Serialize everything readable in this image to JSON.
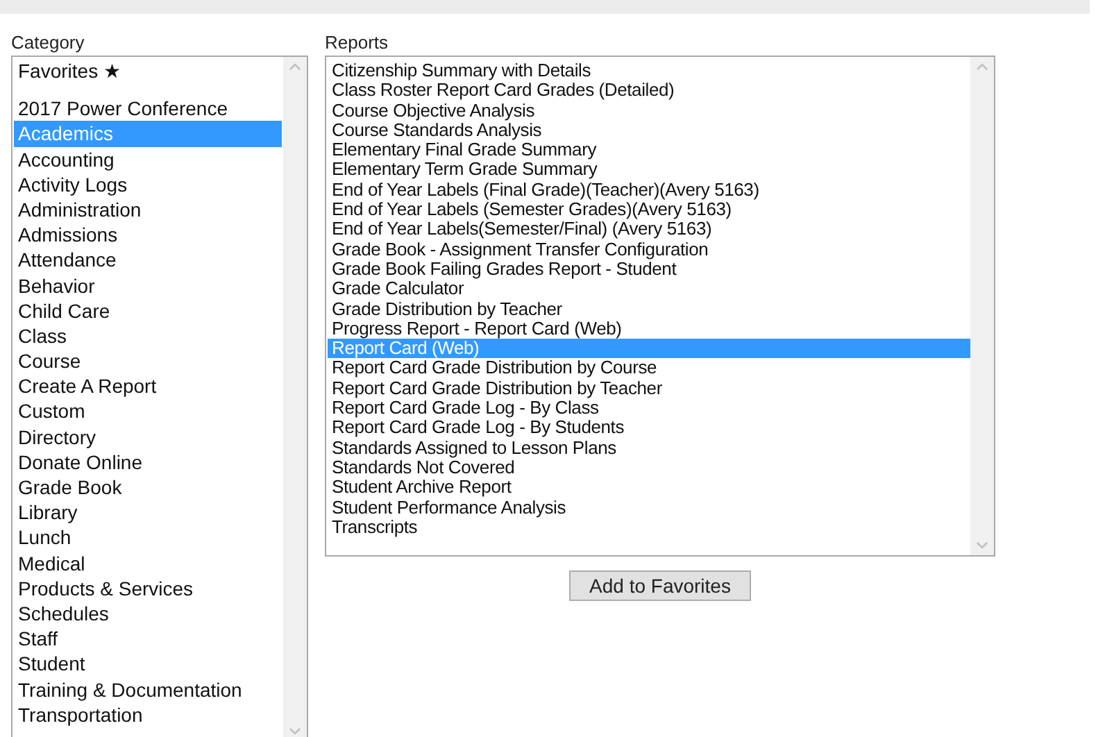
{
  "category": {
    "label": "Category",
    "items": [
      {
        "kind": "favorites",
        "label": "Favorites ★",
        "selected": false
      },
      {
        "kind": "item",
        "label": "2017 Power Conference",
        "selected": false
      },
      {
        "kind": "item",
        "label": "Academics",
        "selected": true
      },
      {
        "kind": "item",
        "label": "Accounting",
        "selected": false
      },
      {
        "kind": "item",
        "label": "Activity Logs",
        "selected": false
      },
      {
        "kind": "item",
        "label": "Administration",
        "selected": false
      },
      {
        "kind": "item",
        "label": "Admissions",
        "selected": false
      },
      {
        "kind": "item",
        "label": "Attendance",
        "selected": false
      },
      {
        "kind": "item",
        "label": "Behavior",
        "selected": false
      },
      {
        "kind": "item",
        "label": "Child Care",
        "selected": false
      },
      {
        "kind": "item",
        "label": "Class",
        "selected": false
      },
      {
        "kind": "item",
        "label": "Course",
        "selected": false
      },
      {
        "kind": "item",
        "label": "Create A Report",
        "selected": false
      },
      {
        "kind": "item",
        "label": "Custom",
        "selected": false
      },
      {
        "kind": "item",
        "label": "Directory",
        "selected": false
      },
      {
        "kind": "item",
        "label": "Donate Online",
        "selected": false
      },
      {
        "kind": "item",
        "label": "Grade Book",
        "selected": false
      },
      {
        "kind": "item",
        "label": "Library",
        "selected": false
      },
      {
        "kind": "item",
        "label": "Lunch",
        "selected": false
      },
      {
        "kind": "item",
        "label": "Medical",
        "selected": false
      },
      {
        "kind": "item",
        "label": "Products & Services",
        "selected": false
      },
      {
        "kind": "item",
        "label": "Schedules",
        "selected": false
      },
      {
        "kind": "item",
        "label": "Staff",
        "selected": false
      },
      {
        "kind": "item",
        "label": "Student",
        "selected": false
      },
      {
        "kind": "item",
        "label": "Training & Documentation",
        "selected": false
      },
      {
        "kind": "item",
        "label": "Transportation",
        "selected": false
      }
    ]
  },
  "reports": {
    "label": "Reports",
    "items": [
      {
        "label": "Citizenship Summary with Details",
        "selected": false
      },
      {
        "label": "Class Roster Report Card Grades (Detailed)",
        "selected": false
      },
      {
        "label": "Course Objective Analysis",
        "selected": false
      },
      {
        "label": "Course Standards Analysis",
        "selected": false
      },
      {
        "label": "Elementary Final Grade Summary",
        "selected": false
      },
      {
        "label": "Elementary Term Grade Summary",
        "selected": false
      },
      {
        "label": "End of Year Labels (Final Grade)(Teacher)(Avery 5163)",
        "selected": false
      },
      {
        "label": "End of Year Labels (Semester Grades)(Avery 5163)",
        "selected": false
      },
      {
        "label": "End of Year Labels(Semester/Final) (Avery 5163)",
        "selected": false
      },
      {
        "label": "Grade Book - Assignment Transfer Configuration",
        "selected": false
      },
      {
        "label": "Grade Book Failing Grades Report - Student",
        "selected": false
      },
      {
        "label": "Grade Calculator",
        "selected": false
      },
      {
        "label": "Grade Distribution by Teacher",
        "selected": false
      },
      {
        "label": "Progress Report - Report Card (Web)",
        "selected": false
      },
      {
        "label": "Report Card (Web)",
        "selected": true
      },
      {
        "label": "Report Card Grade Distribution by Course",
        "selected": false
      },
      {
        "label": "Report Card Grade Distribution by Teacher",
        "selected": false
      },
      {
        "label": "Report Card Grade Log - By Class",
        "selected": false
      },
      {
        "label": "Report Card Grade Log - By Students",
        "selected": false
      },
      {
        "label": "Standards Assigned to Lesson Plans",
        "selected": false
      },
      {
        "label": "Standards Not Covered",
        "selected": false
      },
      {
        "label": "Student Archive Report",
        "selected": false
      },
      {
        "label": "Student Performance Analysis",
        "selected": false
      },
      {
        "label": "Transcripts",
        "selected": false
      }
    ]
  },
  "button": "Add to Favorites"
}
